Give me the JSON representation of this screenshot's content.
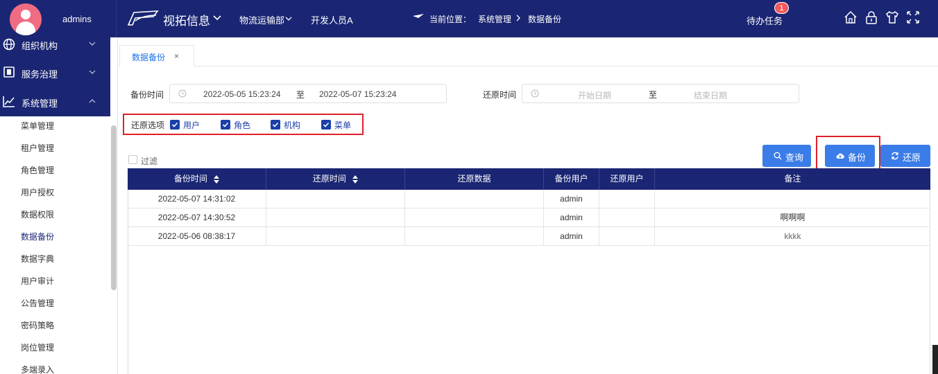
{
  "header": {
    "username": "admins",
    "brand": "视拓信息",
    "menus": [
      "物流运输部",
      "开发人员A"
    ],
    "location_label": "当前位置：",
    "breadcrumb": [
      "系统管理",
      "数据备份"
    ],
    "todo_label": "待办任务",
    "todo_count": "1",
    "icons": [
      "home-icon",
      "lock-icon",
      "shirt-icon",
      "fullscreen-icon"
    ]
  },
  "sidebar": {
    "groups": [
      {
        "label": "组织机构",
        "icon": "globe-icon"
      },
      {
        "label": "服务治理",
        "icon": "service-icon"
      },
      {
        "label": "系统管理",
        "icon": "chart-icon"
      }
    ],
    "items": [
      "菜单管理",
      "租户管理",
      "角色管理",
      "用户授权",
      "数据权限",
      "数据备份",
      "数据字典",
      "用户审计",
      "公告管理",
      "密码策略",
      "岗位管理",
      "多端录入"
    ],
    "active_item": "数据备份"
  },
  "tab": {
    "label": "数据备份",
    "close": "×"
  },
  "filters": {
    "backup_time_label": "备份时间",
    "backup_start": "2022-05-05 15:23:24",
    "backup_end": "2022-05-07 15:23:24",
    "range_sep": "至",
    "restore_time_label": "还原时间",
    "restore_start_placeholder": "开始日期",
    "restore_end_placeholder": "结束日期",
    "restore_options_label": "还原选项",
    "restore_options": [
      {
        "label": "用户",
        "checked": true
      },
      {
        "label": "角色",
        "checked": true
      },
      {
        "label": "机构",
        "checked": true
      },
      {
        "label": "菜单",
        "checked": true
      }
    ],
    "filter_label": "过滤",
    "filter_checked": false
  },
  "buttons": {
    "query": "查询",
    "backup": "备份",
    "restore": "还原"
  },
  "table": {
    "columns": [
      "备份时间",
      "还原时间",
      "还原数据",
      "备份用户",
      "还原用户",
      "备注"
    ],
    "rows": [
      [
        "2022-05-07 14:31:02",
        "",
        "",
        "admin",
        "",
        ""
      ],
      [
        "2022-05-07 14:30:52",
        "",
        "",
        "admin",
        "",
        "啊啊啊"
      ],
      [
        "2022-05-06 08:38:17",
        "",
        "",
        "admin",
        "",
        "kkkk"
      ]
    ]
  },
  "colors": {
    "primary": "#1a2673",
    "button": "#3a7ce8",
    "highlight": "#e0202a",
    "checkbox": "#1a3fa8"
  }
}
